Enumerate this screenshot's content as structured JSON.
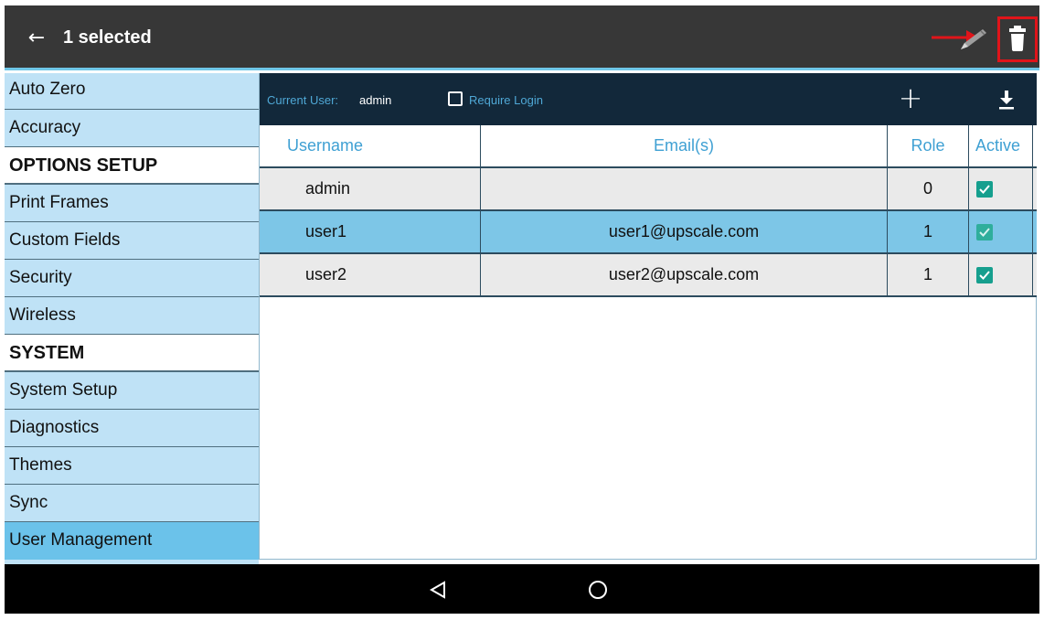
{
  "appbar": {
    "title": "1 selected",
    "back_icon": "arrow-left-icon",
    "edit_icon": "pencil-icon",
    "delete_icon": "trash-icon",
    "bg_color": "#373737",
    "accent": "#6fc7e8"
  },
  "sidebar": {
    "items": [
      {
        "label": "Auto Zero",
        "type": "item"
      },
      {
        "label": "Accuracy",
        "type": "item"
      },
      {
        "label": "OPTIONS SETUP",
        "type": "header"
      },
      {
        "label": "Print Frames",
        "type": "item"
      },
      {
        "label": "Custom Fields",
        "type": "item"
      },
      {
        "label": "Security",
        "type": "item"
      },
      {
        "label": "Wireless",
        "type": "item"
      },
      {
        "label": "SYSTEM",
        "type": "header"
      },
      {
        "label": "System Setup",
        "type": "item"
      },
      {
        "label": "Diagnostics",
        "type": "item"
      },
      {
        "label": "Themes",
        "type": "item"
      },
      {
        "label": "Sync",
        "type": "item"
      },
      {
        "label": "User Management",
        "type": "item",
        "active": true
      }
    ]
  },
  "toolbar": {
    "current_user_label": "Current User:",
    "current_user_value": "admin",
    "require_login_label": "Require Login",
    "require_login_checked": false,
    "add_icon": "plus-icon",
    "download_icon": "download-icon"
  },
  "table": {
    "headers": {
      "username": "Username",
      "email": "Email(s)",
      "role": "Role",
      "active": "Active"
    },
    "rows": [
      {
        "username": "admin",
        "email": "",
        "role": "0",
        "active": true,
        "selected": false
      },
      {
        "username": "user1",
        "email": "user1@upscale.com",
        "role": "1",
        "active": true,
        "selected": true
      },
      {
        "username": "user2",
        "email": "user2@upscale.com",
        "role": "1",
        "active": true,
        "selected": false
      }
    ]
  },
  "navbar": {
    "back_icon": "nav-back-triangle-icon",
    "home_icon": "nav-home-circle-icon"
  }
}
